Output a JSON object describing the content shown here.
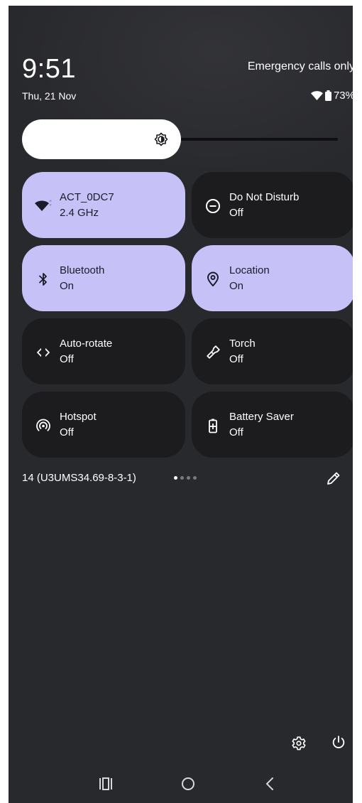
{
  "status_bar": {
    "time": "9:51",
    "carrier": "Emergency calls only",
    "date": "Thu, 21 Nov",
    "battery": "73%"
  },
  "brightness": {
    "level": 0.45
  },
  "tiles": [
    {
      "label": "ACT_0DC7",
      "sublabel": "2.4 GHz",
      "state": "on",
      "icon": "wifi-icon"
    },
    {
      "label": "Do Not Disturb",
      "sublabel": "Off",
      "state": "off",
      "icon": "do-not-disturb-icon"
    },
    {
      "label": "Bluetooth",
      "sublabel": "On",
      "state": "on",
      "icon": "bluetooth-icon"
    },
    {
      "label": "Location",
      "sublabel": "On",
      "state": "on",
      "icon": "location-icon"
    },
    {
      "label": "Auto-rotate",
      "sublabel": "Off",
      "state": "off",
      "icon": "auto-rotate-icon"
    },
    {
      "label": "Torch",
      "sublabel": "Off",
      "state": "off",
      "icon": "torch-icon"
    },
    {
      "label": "Hotspot",
      "sublabel": "Off",
      "state": "off",
      "icon": "hotspot-icon"
    },
    {
      "label": "Battery Saver",
      "sublabel": "Off",
      "state": "off",
      "icon": "battery-saver-icon"
    }
  ],
  "footer": {
    "build_number": "14 (U3UMS34.69-8-3-1)",
    "page_count": 4,
    "active_page": 1
  },
  "icons": {
    "edit": "pencil-icon",
    "settings": "gear-icon",
    "power": "power-icon",
    "nav_recents": "recents-icon",
    "nav_home": "home-icon",
    "nav_back": "back-icon"
  },
  "colors": {
    "background": "#28292d",
    "tile_on": "#c6c2f8",
    "tile_off": "#1c1c1e",
    "text_on": "#1c1b2a",
    "text_off": "#ffffff"
  }
}
